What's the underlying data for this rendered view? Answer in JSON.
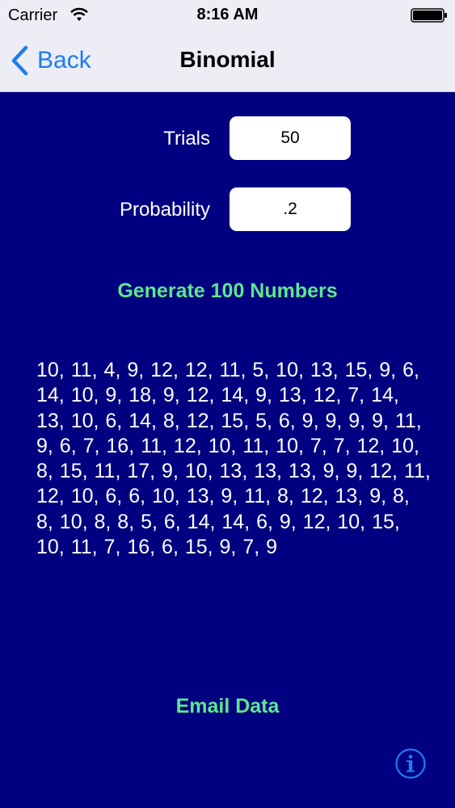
{
  "status_bar": {
    "carrier": "Carrier",
    "time": "8:16 AM",
    "wifi_icon": "wifi-icon",
    "battery_icon": "battery-icon"
  },
  "nav": {
    "back_label": "Back",
    "back_icon": "chevron-left-icon",
    "title": "Binomial"
  },
  "form": {
    "trials_label": "Trials",
    "trials_value": "50",
    "probability_label": "Probability",
    "probability_value": ".2"
  },
  "actions": {
    "generate_label": "Generate 100 Numbers",
    "email_label": "Email Data",
    "info_icon": "info-icon"
  },
  "output": {
    "numbers_text": "10, 11, 4, 9, 12, 12, 11, 5, 10, 13, 15, 9, 6, 14, 10, 9, 18, 9, 12, 14, 9, 13, 12, 7, 14, 13, 10, 6, 14, 8, 12, 15, 5, 6, 9, 9, 9, 9, 11, 9, 6, 7, 16, 11, 12, 10, 11, 10, 7, 7, 12, 10, 8, 15, 11, 17, 9, 10, 13, 13, 13, 9, 9, 12, 11, 12, 10, 6, 6, 10, 13, 9, 11, 8, 12, 13, 9, 8, 8, 10, 8, 8, 5, 6, 14, 14, 6, 9, 12, 10, 15, 10, 11, 7, 16, 6, 15, 9, 7, 9"
  },
  "colors": {
    "background": "#000080",
    "bar_background": "#ECEDF5",
    "accent_blue": "#1E7CF2",
    "action_green": "#5CE88C",
    "text_white": "#FFFFFF"
  }
}
